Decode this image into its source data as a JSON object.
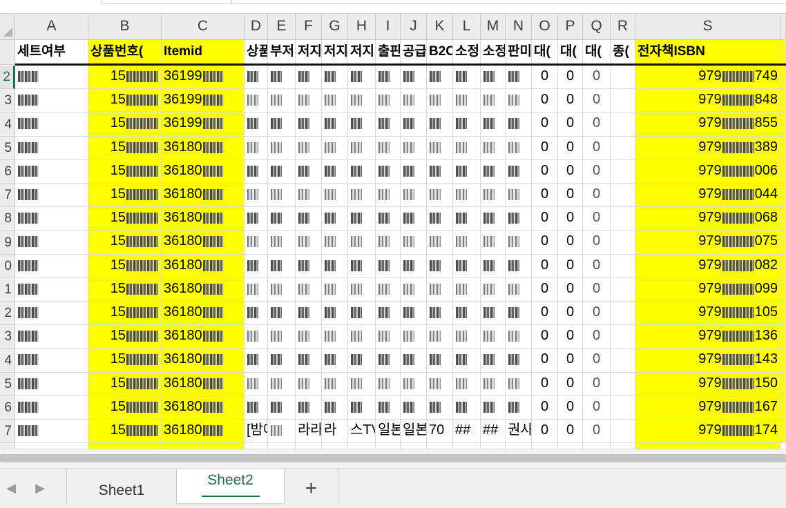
{
  "sheet": {
    "columns": [
      "A",
      "B",
      "C",
      "D",
      "E",
      "F",
      "G",
      "H",
      "I",
      "J",
      "K",
      "L",
      "M",
      "N",
      "O",
      "P",
      "Q",
      "R",
      "S"
    ],
    "header_row": {
      "A": "세트여부",
      "B": "상품번호(",
      "C": "Itemid",
      "D": "상품",
      "E": "부저",
      "F": "저지",
      "G": "저지",
      "H": "저지",
      "I": "출판",
      "J": "공급",
      "K": "B2C",
      "L": "소정",
      "M": "소정",
      "N": "판미",
      "O": "대(",
      "P": "대(",
      "Q": "대(",
      "R": "종(",
      "S": "전자책ISBN"
    },
    "row_numbers": [
      "2",
      "3",
      "4",
      "5",
      "6",
      "7",
      "8",
      "9",
      "0",
      "1",
      "2",
      "3",
      "4",
      "5",
      "6",
      "7"
    ],
    "rows": [
      {
        "B_prefix": "15",
        "C_prefix": "36199",
        "S_prefix": "979",
        "S_suffix": "749",
        "O": "0"
      },
      {
        "B_prefix": "15",
        "C_prefix": "36199",
        "S_prefix": "979",
        "S_suffix": "848",
        "O": "0"
      },
      {
        "B_prefix": "15",
        "C_prefix": "36199",
        "S_prefix": "979",
        "S_suffix": "855",
        "O": "0"
      },
      {
        "B_prefix": "15",
        "C_prefix": "36180",
        "S_prefix": "979",
        "S_suffix": "389",
        "O": "0"
      },
      {
        "B_prefix": "15",
        "C_prefix": "36180",
        "S_prefix": "979",
        "S_suffix": "006",
        "O": "0"
      },
      {
        "B_prefix": "15",
        "C_prefix": "36180",
        "S_prefix": "979",
        "S_suffix": "044",
        "O": "0"
      },
      {
        "B_prefix": "15",
        "C_prefix": "36180",
        "S_prefix": "979",
        "S_suffix": "068",
        "O": "0"
      },
      {
        "B_prefix": "15",
        "C_prefix": "36180",
        "S_prefix": "979",
        "S_suffix": "075",
        "O": "0"
      },
      {
        "B_prefix": "15",
        "C_prefix": "36180",
        "S_prefix": "979",
        "S_suffix": "082",
        "O": "0"
      },
      {
        "B_prefix": "15",
        "C_prefix": "36180",
        "S_prefix": "979",
        "S_suffix": "099",
        "O": "0"
      },
      {
        "B_prefix": "15",
        "C_prefix": "36180",
        "S_prefix": "979",
        "S_suffix": "105",
        "O": "0"
      },
      {
        "B_prefix": "15",
        "C_prefix": "36180",
        "S_prefix": "979",
        "S_suffix": "136",
        "O": "0"
      },
      {
        "B_prefix": "15",
        "C_prefix": "36180",
        "S_prefix": "979",
        "S_suffix": "143",
        "O": "0"
      },
      {
        "B_prefix": "15",
        "C_prefix": "36180",
        "S_prefix": "979",
        "S_suffix": "150",
        "O": "0"
      },
      {
        "B_prefix": "15",
        "C_prefix": "36180",
        "S_prefix": "979",
        "S_suffix": "167",
        "O": "0"
      },
      {
        "B_prefix": "15",
        "C_prefix": "36180",
        "S_prefix": "979",
        "S_suffix": "174",
        "O": "0",
        "D": "[밤에",
        "F": "라라",
        "G": "라",
        "H": "스TV",
        "I": "일본",
        "J": "일본",
        "K": "70",
        "L": "##",
        "M": "##",
        "N": "권사"
      }
    ]
  },
  "tabs": {
    "sheet1": "Sheet1",
    "sheet2": "Sheet2",
    "add": "+"
  },
  "icons": {
    "prev": "chevron-left-icon",
    "next": "chevron-right-icon",
    "add": "plus-icon"
  },
  "colors": {
    "highlight": "#ffff00",
    "accent": "#1e7145"
  }
}
